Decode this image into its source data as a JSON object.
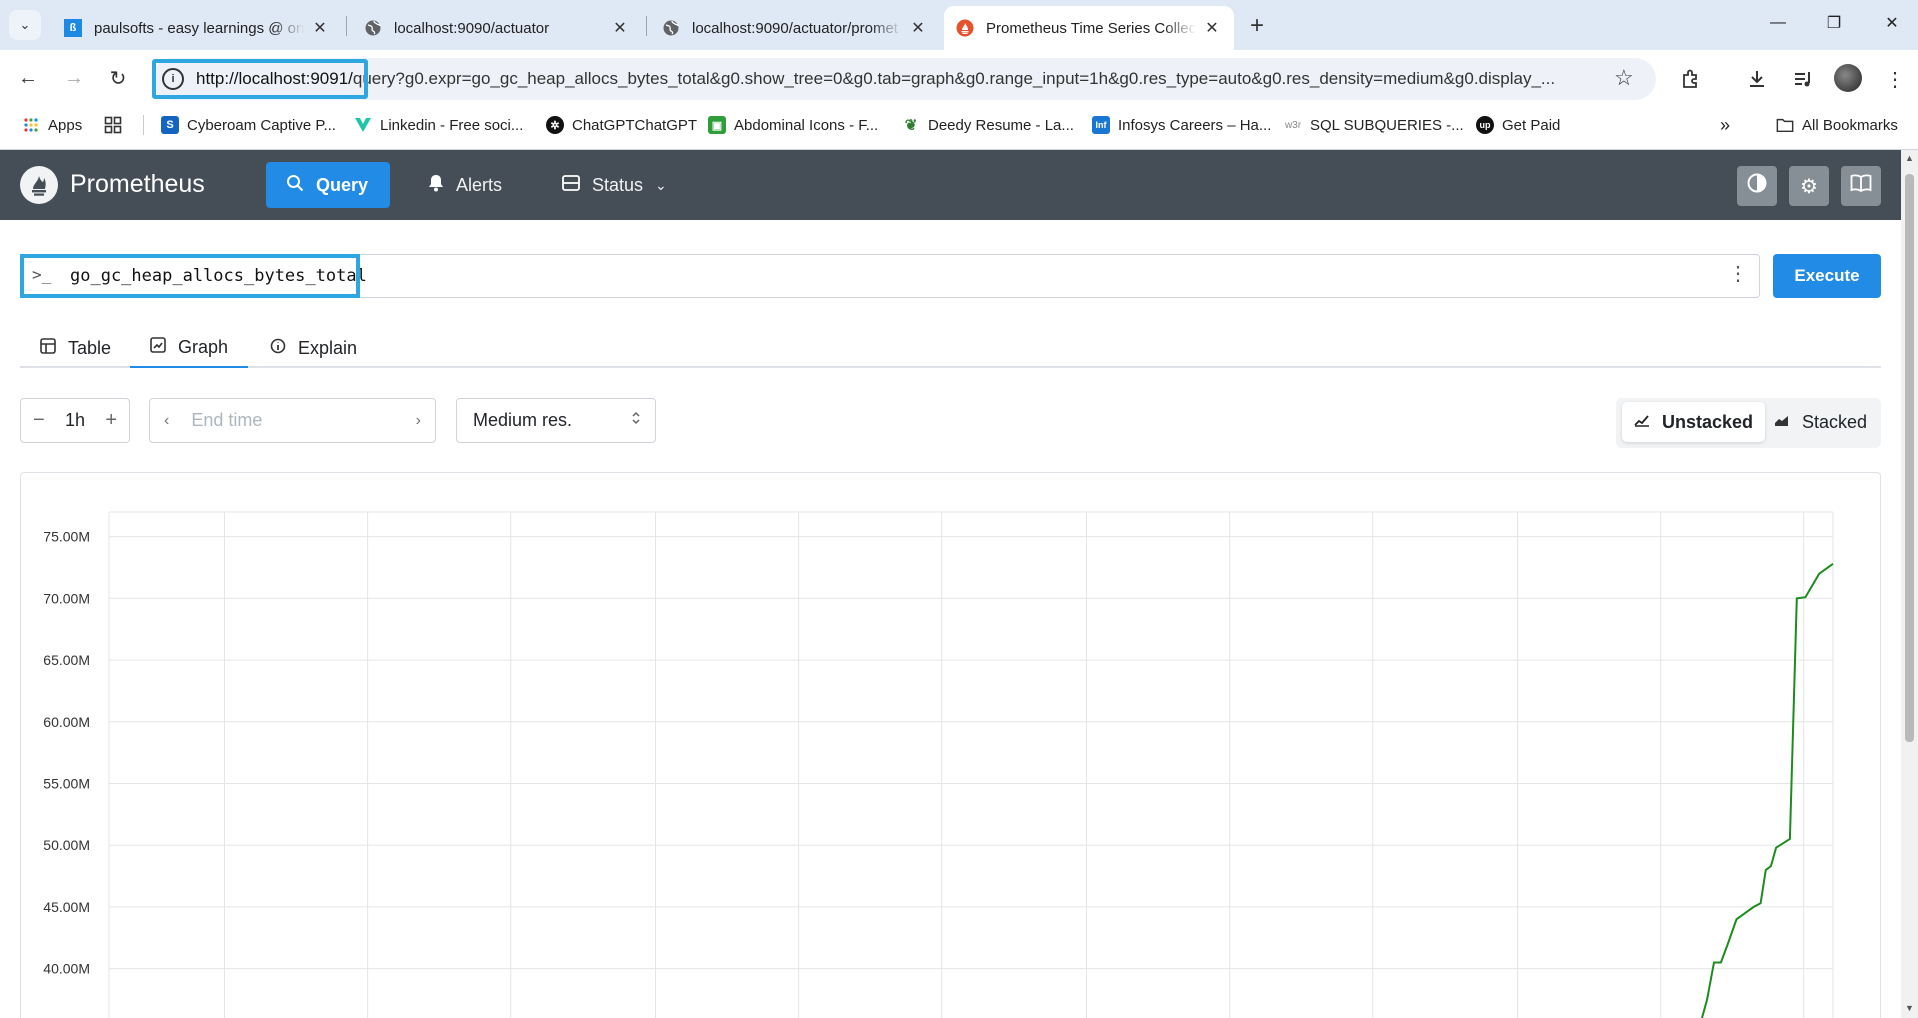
{
  "browser": {
    "tabs": [
      {
        "title": "paulsofts - easy learnings @ on",
        "favicon": "paulsofts-icon",
        "active": false
      },
      {
        "title": "localhost:9090/actuator",
        "favicon": "globe-icon",
        "active": false
      },
      {
        "title": "localhost:9090/actuator/promet",
        "favicon": "globe-icon",
        "active": false
      },
      {
        "title": "Prometheus Time Series Collect",
        "favicon": "prometheus-icon",
        "active": true
      }
    ],
    "url_host": "http://localhost:9091/",
    "url_rest": "query?g0.expr=go_gc_heap_allocs_bytes_total&g0.show_tree=0&g0.tab=graph&g0.range_input=1h&g0.res_type=auto&g0.res_density=medium&g0.display_...",
    "bookmarks": [
      {
        "label": "Apps",
        "icon": "apps-grid-icon"
      },
      {
        "label": "",
        "icon": "tab-groups-icon"
      },
      {
        "label": "Cyberoam Captive P...",
        "icon": "cyberoam-icon"
      },
      {
        "label": "Linkedin - Free soci...",
        "icon": "linkedin-icon"
      },
      {
        "label": "ChatGPTChatGPT",
        "icon": "chatgpt-icon"
      },
      {
        "label": "Abdominal Icons - F...",
        "icon": "abdominal-icon"
      },
      {
        "label": "Deedy Resume - La...",
        "icon": "overleaf-icon"
      },
      {
        "label": "Infosys Careers – Ha...",
        "icon": "infosys-icon"
      },
      {
        "label": "SQL SUBQUERIES -...",
        "icon": "w3r-icon"
      },
      {
        "label": "Get Paid",
        "icon": "upwork-icon"
      }
    ],
    "all_bookmarks": "All Bookmarks"
  },
  "app": {
    "brand": "Prometheus",
    "nav": [
      {
        "label": "Query",
        "icon": "search-icon",
        "active": true
      },
      {
        "label": "Alerts",
        "icon": "bell-icon",
        "active": false
      },
      {
        "label": "Status",
        "icon": "server-icon",
        "active": false
      }
    ]
  },
  "query": {
    "expression": "go_gc_heap_allocs_bytes_total",
    "execute_label": "Execute"
  },
  "panel_tabs": [
    {
      "label": "Table",
      "icon": "table-icon",
      "active": false
    },
    {
      "label": "Graph",
      "icon": "graph-icon",
      "active": true
    },
    {
      "label": "Explain",
      "icon": "info-icon",
      "active": false
    }
  ],
  "controls": {
    "range": "1h",
    "end_time_placeholder": "End time",
    "resolution": "Medium res.",
    "unstacked_label": "Unstacked",
    "stacked_label": "Stacked"
  },
  "chart_data": {
    "type": "line",
    "y_tick_labels": [
      "75.00M",
      "70.00M",
      "65.00M",
      "60.00M",
      "55.00M",
      "50.00M",
      "45.00M",
      "40.00M"
    ],
    "y_ticks": [
      75000000,
      70000000,
      65000000,
      60000000,
      55000000,
      50000000,
      45000000,
      40000000
    ],
    "ylim": [
      36000000,
      77000000
    ],
    "grid": true,
    "series": [
      {
        "color": "#1c8c1c",
        "points": [
          [
            0.924,
            36000000
          ],
          [
            0.927,
            37500000
          ],
          [
            0.931,
            40500000
          ],
          [
            0.935,
            40500000
          ],
          [
            0.939,
            42000000
          ],
          [
            0.944,
            44000000
          ],
          [
            0.949,
            44500000
          ],
          [
            0.954,
            45000000
          ],
          [
            0.958,
            45300000
          ],
          [
            0.961,
            48000000
          ],
          [
            0.964,
            48300000
          ],
          [
            0.967,
            49800000
          ],
          [
            0.975,
            50500000
          ],
          [
            0.979,
            70000000
          ],
          [
            0.984,
            70100000
          ],
          [
            0.992,
            72000000
          ],
          [
            1.0,
            72800000
          ]
        ]
      }
    ]
  },
  "colors": {
    "header": "#454e57",
    "accent": "#228be6",
    "highlight": "#2ea7e0",
    "series": "#1c8c1c"
  }
}
